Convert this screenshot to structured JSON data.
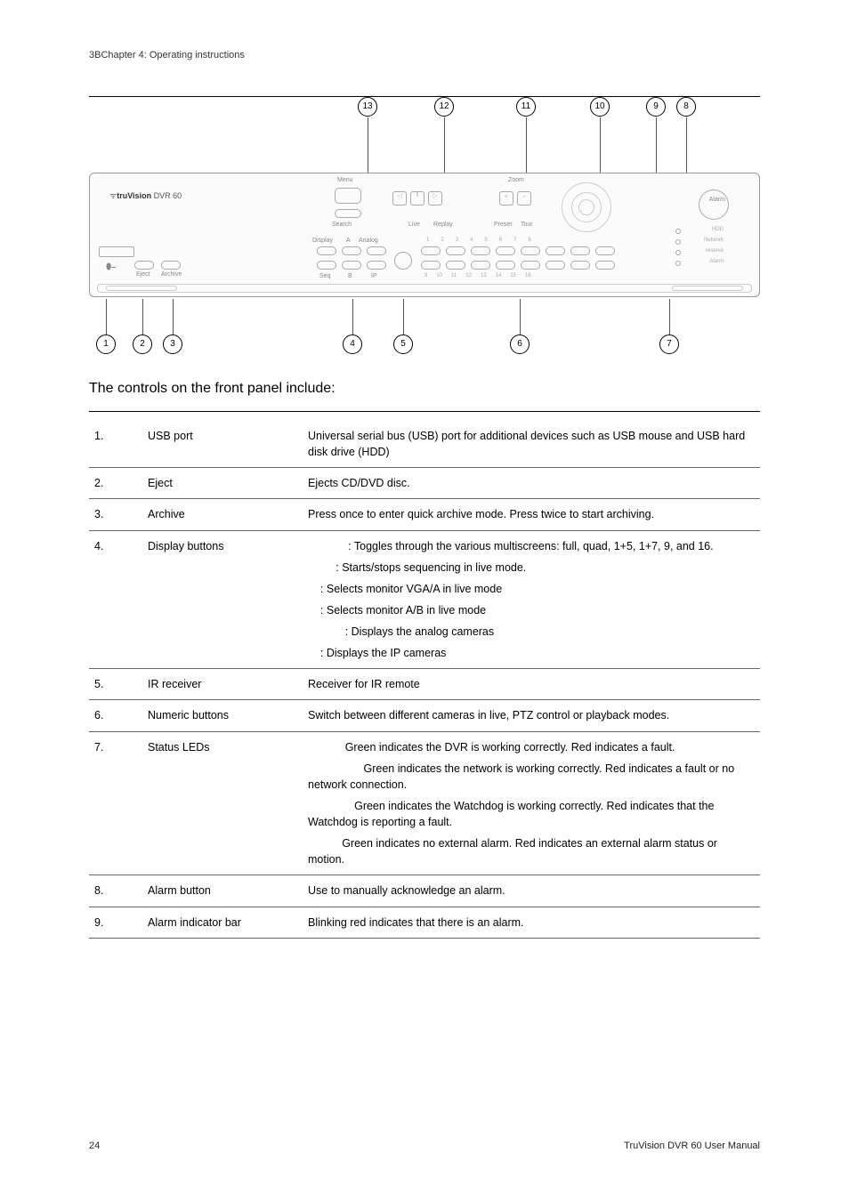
{
  "header": "3BChapter 4: Operating instructions",
  "diagram": {
    "brand_pre": "tru",
    "brand_bold": "Vision",
    "brand_suffix": " DVR 60",
    "top_callouts": [
      "13",
      "12",
      "11",
      "10",
      "9",
      "8"
    ],
    "bottom_callouts": [
      "1",
      "2",
      "3",
      "4",
      "5",
      "6",
      "7"
    ],
    "front_labels": {
      "menu": "Menu",
      "search": "Search",
      "live": "Live",
      "replay": "Replay",
      "zoom": "Zoom",
      "preset": "Preset",
      "tour": "Tour",
      "display": "Display",
      "a": "A",
      "analog": "Analog",
      "seq": "Seq",
      "b": "B",
      "ip": "IP",
      "eject": "Eject",
      "archive": "Archive",
      "alarm": "Alarm",
      "hdd": "HDD",
      "network": "Network",
      "reserve": "reserve",
      "alarm2": "Alarm"
    }
  },
  "intro": "The controls on the front panel include:",
  "rows": [
    {
      "num": "1.",
      "name": "USB port",
      "descs": [
        "Universal serial bus (USB) port for additional devices such as USB mouse and USB hard disk drive (HDD)"
      ]
    },
    {
      "num": "2.",
      "name": "Eject",
      "descs": [
        "Ejects CD/DVD disc."
      ]
    },
    {
      "num": "3.",
      "name": "Archive",
      "descs": [
        "Press once to enter quick archive mode. Press twice to start archiving."
      ]
    },
    {
      "num": "4.",
      "name": "Display buttons",
      "descs": [
        "             : Toggles through the various multiscreens: full, quad, 1+5, 1+7, 9, and 16.",
        "         : Starts/stops sequencing in live mode.",
        "    : Selects monitor VGA/A in live mode",
        "    : Selects monitor A/B in live mode",
        "            : Displays the analog cameras",
        "    : Displays the IP cameras"
      ]
    },
    {
      "num": "5.",
      "name": "IR receiver",
      "descs": [
        "Receiver for IR remote"
      ]
    },
    {
      "num": "6.",
      "name": "Numeric buttons",
      "descs": [
        "Switch between different cameras in live, PTZ control or playback modes."
      ]
    },
    {
      "num": "7.",
      "name": "Status LEDs",
      "descs": [
        "            Green indicates the DVR is working correctly. Red indicates a fault.",
        "                  Green indicates the network is working correctly. Red indicates a fault or no network connection.",
        "               Green indicates the Watchdog is working correctly. Red indicates that the Watchdog is reporting a fault.",
        "           Green indicates no external alarm. Red indicates an external alarm status or motion."
      ]
    },
    {
      "num": "8.",
      "name": "Alarm button",
      "descs": [
        "Use to manually acknowledge an alarm."
      ]
    },
    {
      "num": "9.",
      "name": "Alarm indicator bar",
      "descs": [
        "Blinking red indicates that there is an alarm."
      ]
    }
  ],
  "footer": {
    "page": "24",
    "doc": "TruVision DVR 60 User Manual"
  }
}
